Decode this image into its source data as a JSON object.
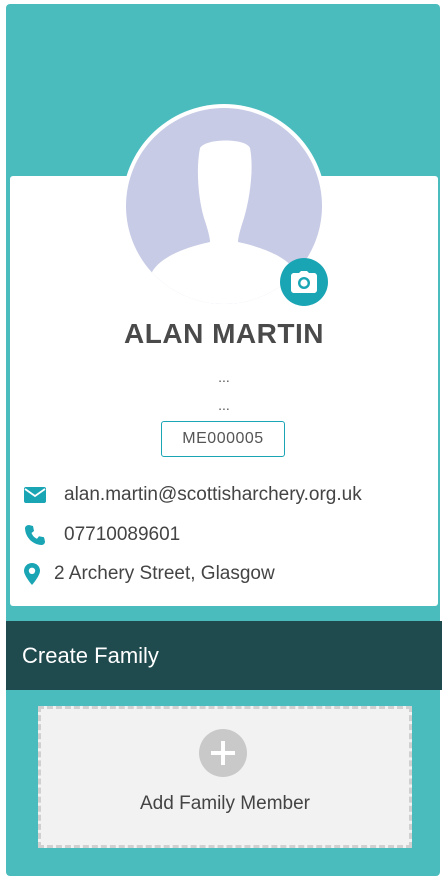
{
  "profile": {
    "name": "ALAN MARTIN",
    "line1": "...",
    "line2": "...",
    "member_id": "ME000005"
  },
  "contact": {
    "email": "alan.martin@scottisharchery.org.uk",
    "phone": "07710089601",
    "address": "2 Archery Street, Glasgow"
  },
  "family": {
    "header": "Create Family",
    "add_label": "Add Family Member"
  },
  "icons": {
    "camera": "camera-icon",
    "email": "envelope-icon",
    "phone": "phone-icon",
    "address": "map-marker-icon",
    "add": "plus-icon"
  },
  "colors": {
    "panel": "#4bbcbd",
    "accent": "#1aa5b5",
    "header": "#1f4a4e",
    "avatar_bg": "#c7cbe5"
  }
}
